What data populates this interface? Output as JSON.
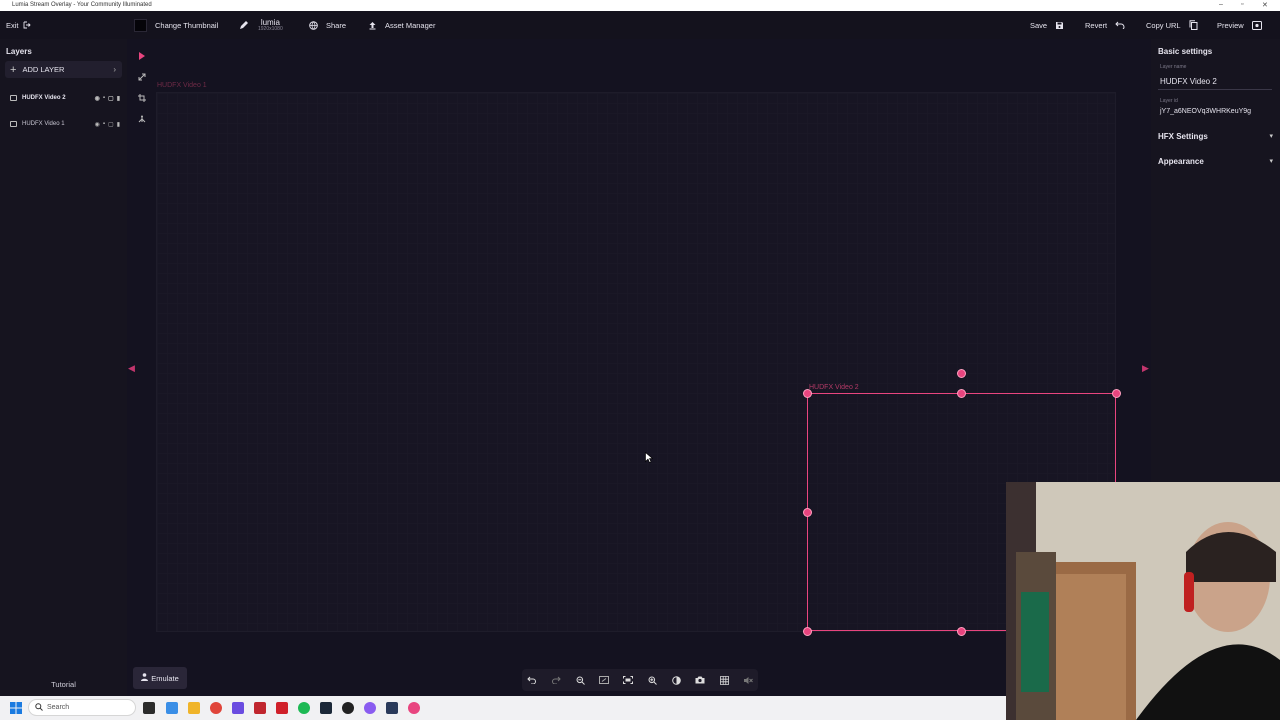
{
  "window": {
    "title": "Lumia Stream Overlay - Your Community Illuminated"
  },
  "topbar": {
    "exit_label": "Exit",
    "change_thumbnail_label": "Change Thumbnail",
    "project_name": "lumia",
    "project_resolution": "1920x1080",
    "share_label": "Share",
    "asset_manager_label": "Asset Manager",
    "save_label": "Save",
    "revert_label": "Revert",
    "copy_url_label": "Copy URL",
    "preview_label": "Preview"
  },
  "layers_panel": {
    "title": "Layers",
    "add_layer_label": "ADD LAYER",
    "layers": [
      {
        "name": "HUDFX Video 2"
      },
      {
        "name": "HUDFX Video 1"
      }
    ],
    "tutorial_label": "Tutorial"
  },
  "canvas": {
    "layer1_label": "HUDFX Video 1",
    "layer2_label": "HUDFX Video 2"
  },
  "emulate_label": "Emulate",
  "settings_panel": {
    "basic_settings_title": "Basic settings",
    "layer_name_label": "Layer name",
    "layer_name_value": "HUDFX Video 2",
    "layer_id_label": "Layer id",
    "layer_id_value": "jY7_a6NEOVq3WHRKeuY9g",
    "hfx_settings_title": "HFX Settings",
    "appearance_title": "Appearance"
  },
  "taskbar": {
    "search_placeholder": "Search"
  },
  "colors": {
    "accent": "#e8457f",
    "background": "#13111c",
    "panel": "#16141f"
  }
}
